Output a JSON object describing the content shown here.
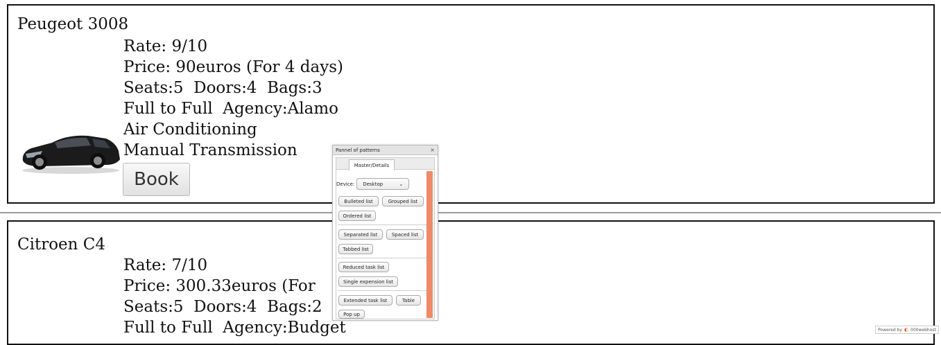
{
  "cars": [
    {
      "name": "Peugeot 3008",
      "rate": "Rate: 9/10",
      "price": "Price: 90euros (For 4 days)",
      "specs": "Seats:5  Doors:4  Bags:3",
      "fuel_agency": "Full to Full  Agency:Alamo",
      "ac": "Air Conditioning",
      "transmission": "Manual Transmission",
      "book_label": "Book"
    },
    {
      "name": "Citroen C4",
      "rate": "Rate: 7/10",
      "price": "Price: 300.33euros (For",
      "specs": "Seats:5  Doors:4  Bags:2",
      "fuel_agency": "Full to Full  Agency:Budget"
    }
  ],
  "panel": {
    "title": "Pannel of patterns",
    "close": "×",
    "tab": "Master/Details",
    "device_label": "Device:",
    "device_value": "Desktop",
    "buttons": {
      "bulleted": "Bulleted list",
      "grouped": "Grouped list",
      "ordered": "Ordered list",
      "separated": "Separated list",
      "spaced": "Spaced list",
      "tabbed": "Tabbed list",
      "reduced": "Reduced task list",
      "single": "Single expension list",
      "extended": "Extended task list",
      "table": "Table",
      "popup": "Pop up"
    },
    "scrollbar_color": "#ef8a67"
  },
  "powered": {
    "prefix": "Powered by",
    "brand": "000webhost"
  }
}
